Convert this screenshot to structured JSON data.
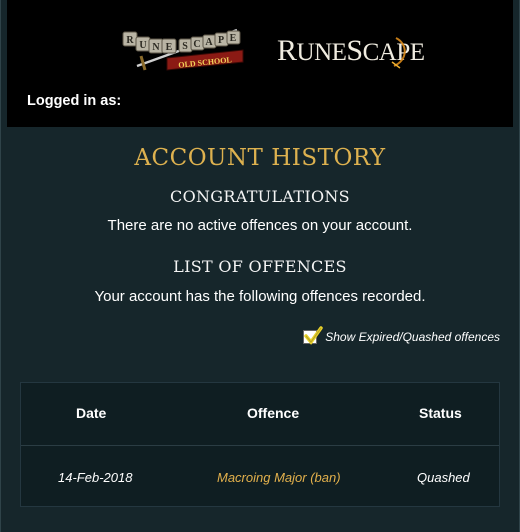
{
  "header": {
    "logged_in_label": "Logged in as:",
    "logo_osrs_words": [
      "RUNE",
      "SCAPE",
      "OLD SCHOOL"
    ],
    "logo_rs_text": "RuneScape"
  },
  "page": {
    "title": "ACCOUNT HISTORY",
    "congrats_heading": "CONGRATULATIONS",
    "congrats_text": "There are no active offences on your account.",
    "list_heading": "LIST OF OFFENCES",
    "list_text": "Your account has the following offences recorded.",
    "show_expired_label": "Show Expired/Quashed offences",
    "show_expired_checked": true
  },
  "table": {
    "headers": [
      "Date",
      "Offence",
      "Status"
    ],
    "rows": [
      {
        "date": "14-Feb-2018",
        "offence": "Macroing Major (ban)",
        "status": "Quashed"
      }
    ]
  },
  "colors": {
    "background": "#16262b",
    "header_bg": "#000000",
    "title_gold": "#ddb14f",
    "offence_gold": "#e2b04c",
    "check_yellow": "#e8d12a"
  }
}
